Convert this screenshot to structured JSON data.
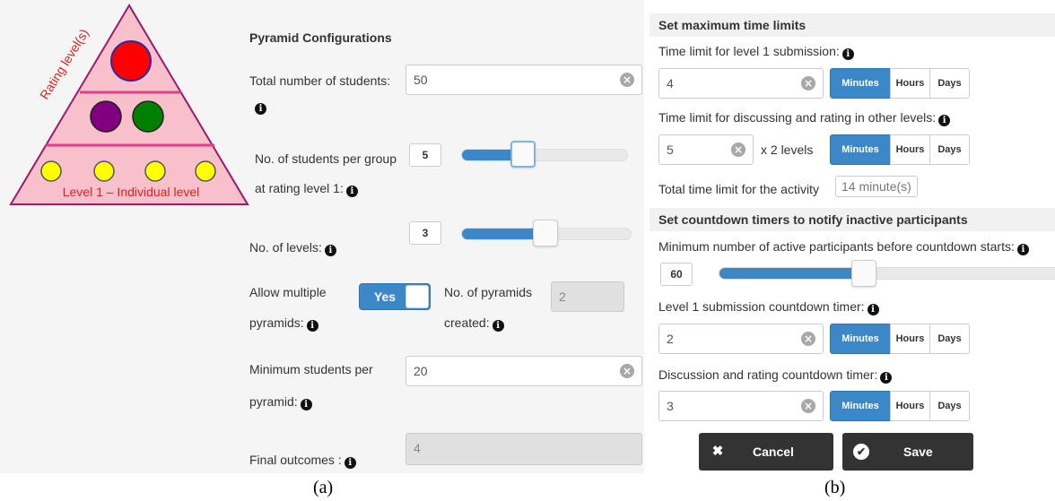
{
  "panel_a": {
    "diagram": {
      "rating_levels_label": "Rating level(s)",
      "level1_label": "Level 1 – Individual level",
      "colors": {
        "fill": "#f8c0ca",
        "stroke": "#9b1a6e",
        "line": "#e33d8c",
        "top_node": "#ff0000",
        "mid_node_1": "#800080",
        "mid_node_2": "#008000",
        "leaf_node": "#ffff00",
        "text": "#e02020"
      }
    },
    "heading": "Pyramid Configurations",
    "total_students": {
      "label": "Total number of students:",
      "value": "50"
    },
    "students_per_group": {
      "label_line1": "No. of students per group",
      "label_line2": "at rating level 1:",
      "value": "5",
      "slider_fraction": 0.4
    },
    "levels": {
      "label": "No. of levels:",
      "value": "3",
      "slider_fraction": 0.55
    },
    "multiple_pyramids": {
      "label_line1": "Allow multiple",
      "label_line2": "pyramids:",
      "toggle": "Yes"
    },
    "pyramids_created": {
      "label_line1": "No. of pyramids",
      "label_line2": "created:",
      "value": "2"
    },
    "min_students": {
      "label_line1": "Minimum students per",
      "label_line2": "pyramid:",
      "value": "20"
    },
    "final_outcomes": {
      "label": "Final outcomes :",
      "value": "4"
    }
  },
  "panel_b": {
    "time_limits_heading": "Set maximum time limits",
    "level1_limit": {
      "label": "Time limit for level 1 submission:",
      "value": "4"
    },
    "discussion_limit": {
      "label": "Time limit for discussing and rating in other levels:",
      "value": "5",
      "multiplier": "x 2 levels"
    },
    "total_limit": {
      "label": "Total time limit for the activity",
      "value": "14 minute(s)"
    },
    "countdown_heading": "Set countdown timers to notify inactive participants",
    "min_active": {
      "label": "Minimum number of active participants before countdown starts:",
      "value": "60",
      "slider_fraction": 0.4
    },
    "level1_countdown": {
      "label": "Level 1 submission countdown timer:",
      "value": "2"
    },
    "discussion_countdown": {
      "label": "Discussion and rating countdown timer:",
      "value": "3"
    },
    "units": {
      "minutes": "Minutes",
      "hours": "Hours",
      "days": "Days"
    },
    "cancel_label": "Cancel",
    "save_label": "Save"
  },
  "captions": {
    "a": "(a)",
    "b": "(b)"
  },
  "icons": {
    "info": "info-icon",
    "clear": "clear-icon",
    "close": "close-icon",
    "check": "check-icon"
  },
  "accent_color": "#3b87c8"
}
